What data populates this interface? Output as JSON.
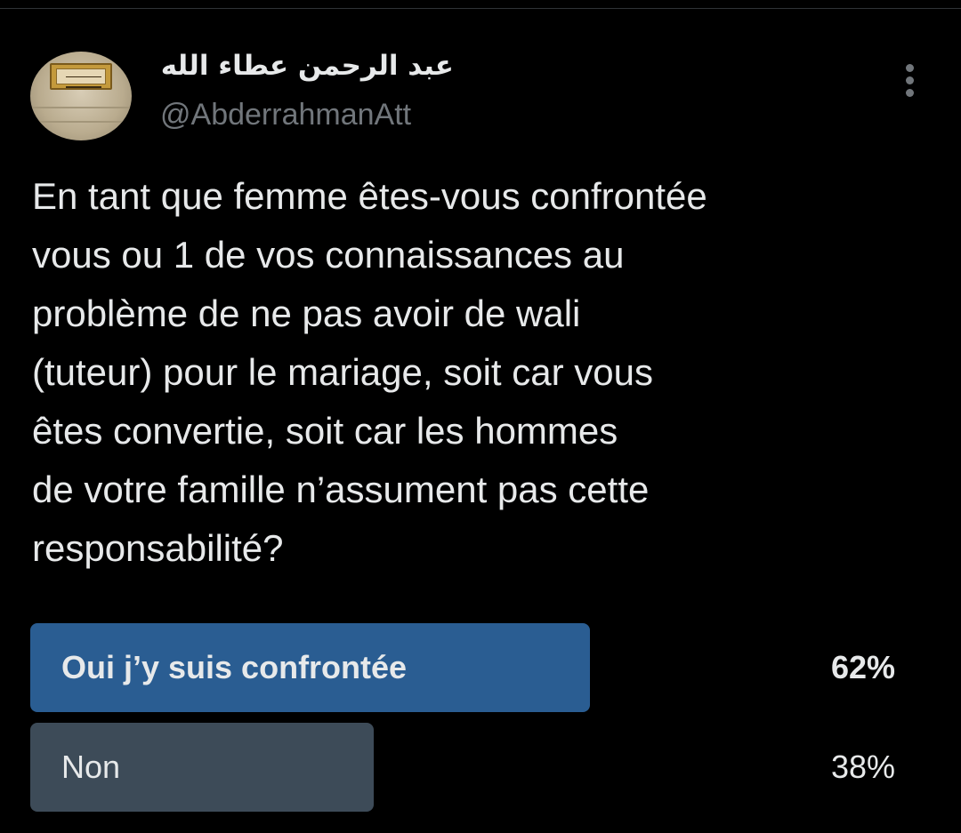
{
  "tweet": {
    "author": {
      "display_name": "عبد الرحمن عطاء الله",
      "handle": "@AbderrahmanAtt"
    },
    "text_lines": [
      "En tant que femme êtes-vous confrontée",
      "vous ou 1 de vos connaissances au",
      "problème de ne pas avoir de wali",
      "(tuteur) pour le mariage, soit car vous",
      "êtes convertie, soit car les hommes",
      "de votre famille n’assument pas cette",
      "responsabilité?"
    ]
  },
  "poll": {
    "options": [
      {
        "label": "Oui j’y suis confrontée",
        "percent_text": "62%",
        "fraction": 0.62,
        "winner": true,
        "bar_color": "#2a5d92"
      },
      {
        "label": "Non",
        "percent_text": "38%",
        "fraction": 0.38,
        "winner": false,
        "bar_color": "#3d4b58"
      }
    ]
  },
  "icons": {
    "more": "vertical-ellipsis-icon"
  },
  "colors": {
    "background": "#000000",
    "text_primary": "#e7e9ea",
    "text_secondary": "#71767b"
  }
}
